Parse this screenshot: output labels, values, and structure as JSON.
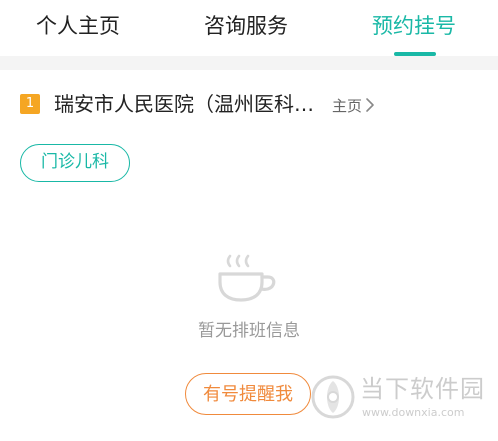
{
  "tabs": [
    {
      "label": "个人主页",
      "active": false
    },
    {
      "label": "咨询服务",
      "active": false
    },
    {
      "label": "预约挂号",
      "active": true
    }
  ],
  "hospital": {
    "rank": "1",
    "name": "瑞安市人民医院（温州医科大学附属第三医院）",
    "homepage_label": "主页"
  },
  "department": {
    "label": "门诊儿科"
  },
  "empty_state": {
    "icon": "coffee-cup-icon",
    "message": "暂无排班信息"
  },
  "remind_button": {
    "label": "有号提醒我"
  },
  "watermark": {
    "title": "当下软件园",
    "url": "www.downxia.com"
  },
  "colors": {
    "accent": "#19b8a6",
    "badge": "#f5a623",
    "remind": "#f08a3c",
    "divider": "#f4f4f4"
  }
}
